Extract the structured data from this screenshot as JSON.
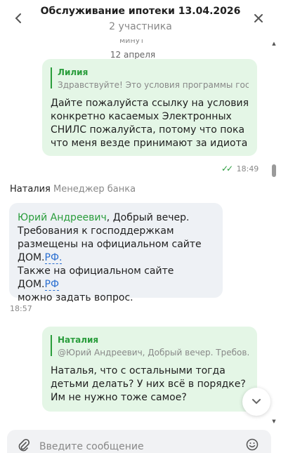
{
  "header": {
    "title": "Обслуживание ипотеки 13.04.2026",
    "subtitle": "2 участника"
  },
  "chat": {
    "cut_text": "минут",
    "date_divider": "12 апреля",
    "messages": [
      {
        "direction": "outgoing",
        "quote_author": "Лилия",
        "quote_text": "Здравствуйте! Это условия программы гос....",
        "text": "Дайте пожалуйста ссылку на условия конкретно касаемых Электронных СНИЛС пожалуйста, потому что пока что меня везде принимают за идиота",
        "time": "18:49",
        "status": "read"
      },
      {
        "direction": "incoming",
        "sender_name": "Наталия",
        "sender_role": "Менеджер банка",
        "mention": "Юрий Андреевич",
        "text_after_mention": ", Добрый вечер. Требования к господдержкам размещены на официальном сайте ДОМ.",
        "link1": "РФ.",
        "text2_before_link": "Также на официальном сайте ДОМ.",
        "link2": "РФ",
        "text2_after_link": "можно задать вопрос.",
        "time": "18:57"
      },
      {
        "direction": "outgoing",
        "quote_author": "Наталия",
        "quote_text": "@Юрий Андреевич, Добрый вечер. Требов...",
        "text": "Наталья, что с остальными тогда детьми делать? У них всё в порядке? Им не нужно тоже самое?"
      }
    ]
  },
  "composer": {
    "placeholder": "Введите сообщение"
  },
  "colors": {
    "outgoing_bubble": "#e4f6e6",
    "incoming_bubble": "#eef1f5",
    "accent_green": "#2a9d3c",
    "link_blue": "#2a6fd1"
  }
}
